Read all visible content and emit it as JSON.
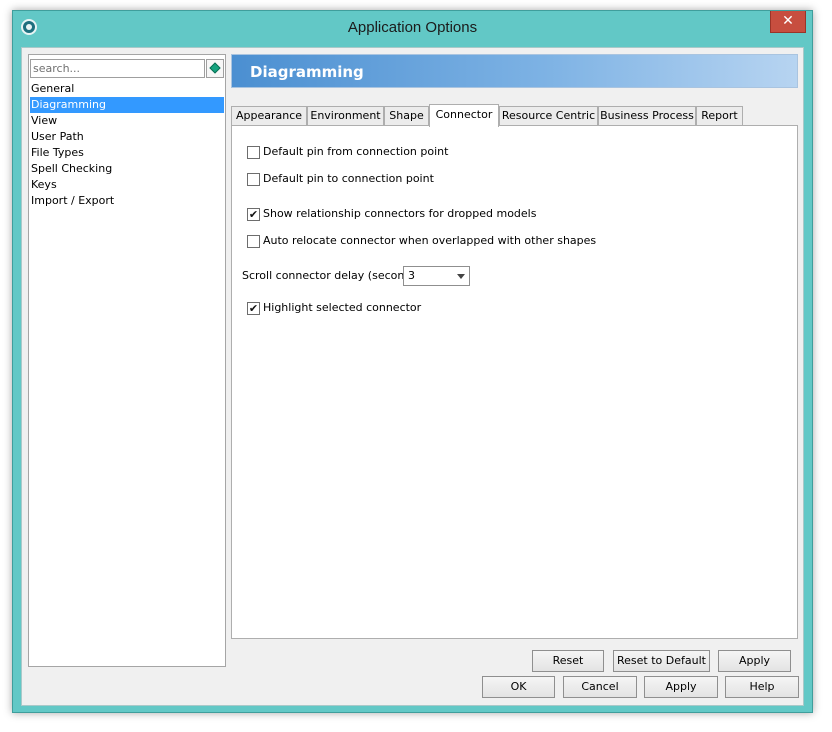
{
  "window": {
    "title": "Application Options",
    "close_glyph": "✕",
    "icon": "app-logo-icon"
  },
  "sidebar": {
    "search_placeholder": "search...",
    "search_button_icon": "diamond-icon",
    "items": [
      "General",
      "Diagramming",
      "View",
      "User Path",
      "File Types",
      "Spell Checking",
      "Keys",
      "Import / Export"
    ],
    "selected_index": 1
  },
  "page": {
    "title": "Diagramming",
    "tabs": [
      "Appearance",
      "Environment",
      "Shape",
      "Connector",
      "Resource Centric",
      "Business Process",
      "Report"
    ],
    "active_tab": "Connector"
  },
  "connector": {
    "options": [
      {
        "label": "Default pin from connection point",
        "checked": false
      },
      {
        "label": "Default pin to connection point",
        "checked": false
      },
      {
        "label": "Show relationship connectors for dropped models",
        "checked": true
      },
      {
        "label": "Auto relocate connector when overlapped with other shapes",
        "checked": false
      },
      {
        "label": "Highlight selected connector",
        "checked": true
      }
    ],
    "scroll_delay_label": "Scroll connector delay (second) :",
    "scroll_delay_value": "3",
    "check_glyph": "✔"
  },
  "panel_buttons": {
    "reset": "Reset",
    "reset_default": "Reset to Default",
    "apply": "Apply"
  },
  "dialog_buttons": {
    "ok": "OK",
    "cancel": "Cancel",
    "apply": "Apply",
    "help": "Help"
  },
  "colors": {
    "frame": "#62c8c6",
    "close": "#c74e3f",
    "banner": "#4b8fd1",
    "selection": "#3399ff"
  }
}
